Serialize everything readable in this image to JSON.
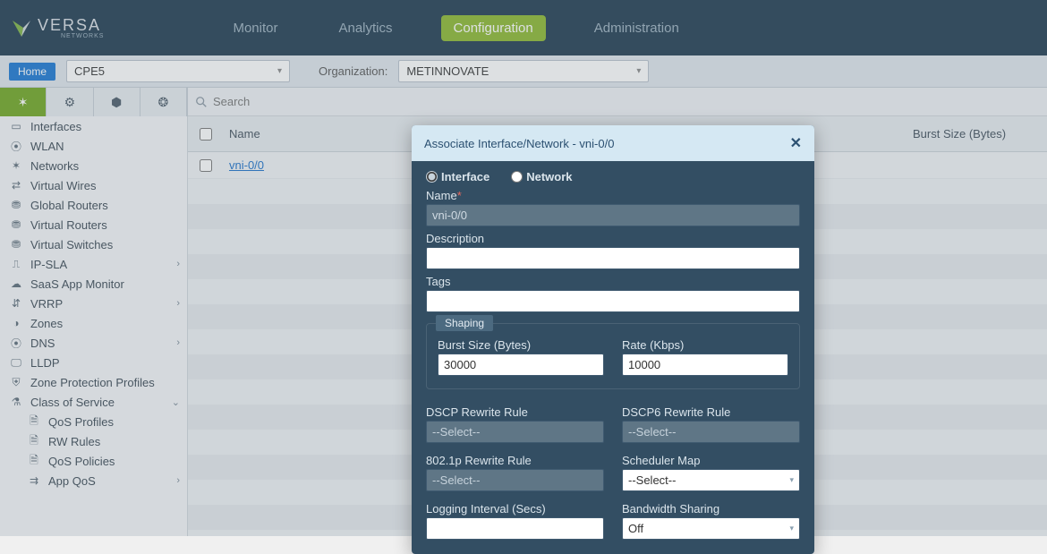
{
  "brand": {
    "name": "VERSA",
    "sub": "NETWORKS"
  },
  "nav": {
    "monitor": "Monitor",
    "analytics": "Analytics",
    "configuration": "Configuration",
    "administration": "Administration"
  },
  "subbar": {
    "home": "Home",
    "device": "CPE5",
    "org_label": "Organization:",
    "org": "METINNOVATE"
  },
  "search": {
    "placeholder": "Search"
  },
  "sidebar": {
    "interfaces": "Interfaces",
    "wlan": "WLAN",
    "networks": "Networks",
    "virtual_wires": "Virtual Wires",
    "global_routers": "Global Routers",
    "virtual_routers": "Virtual Routers",
    "virtual_switches": "Virtual Switches",
    "ip_sla": "IP-SLA",
    "saas": "SaaS App Monitor",
    "vrrp": "VRRP",
    "zones": "Zones",
    "dns": "DNS",
    "lldp": "LLDP",
    "zpp": "Zone Protection Profiles",
    "cos": "Class of Service",
    "qos_profiles": "QoS Profiles",
    "rw_rules": "RW Rules",
    "qos_policies": "QoS Policies",
    "app_qos": "App QoS"
  },
  "table": {
    "col_name": "Name",
    "col_burst": "Burst Size (Bytes)",
    "row0_name": "vni-0/0"
  },
  "modal": {
    "title": "Associate Interface/Network - vni-0/0",
    "radio_interface": "Interface",
    "radio_network": "Network",
    "name_label": "Name",
    "name_value": "vni-0/0",
    "desc_label": "Description",
    "desc_value": "",
    "tags_label": "Tags",
    "tags_value": "",
    "shaping_legend": "Shaping",
    "burst_label": "Burst Size (Bytes)",
    "burst_value": "30000",
    "rate_label": "Rate (Kbps)",
    "rate_value": "10000",
    "dscp_label": "DSCP Rewrite Rule",
    "dscp_value": "--Select--",
    "dscp6_label": "DSCP6 Rewrite Rule",
    "dscp6_value": "--Select--",
    "p8021_label": "802.1p Rewrite Rule",
    "p8021_value": "--Select--",
    "sched_label": "Scheduler Map",
    "sched_value": "--Select--",
    "log_label": "Logging Interval (Secs)",
    "log_value": "",
    "bw_label": "Bandwidth Sharing",
    "bw_value": "Off"
  }
}
